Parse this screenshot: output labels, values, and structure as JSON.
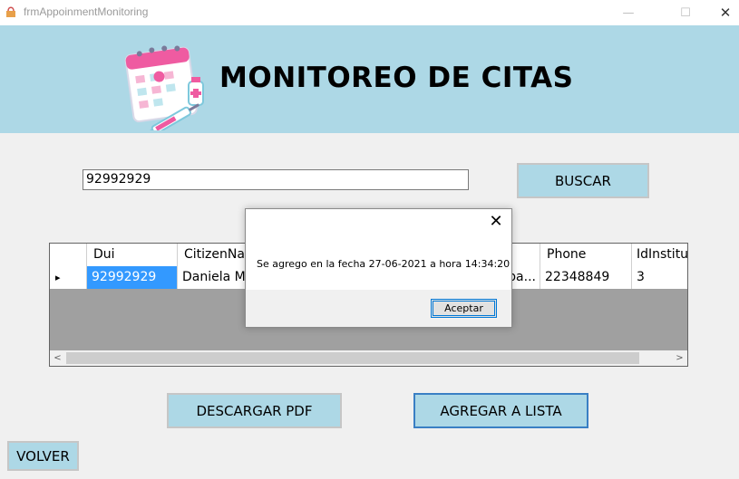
{
  "window": {
    "title": "frmAppoinmentMonitoring",
    "minimize_glyph": "—",
    "maximize_glyph": "☐",
    "close_glyph": "✕"
  },
  "header": {
    "title": "MONITOREO DE CITAS",
    "background": "#add8e6"
  },
  "search": {
    "value": "92992929",
    "button_label": "BUSCAR"
  },
  "grid": {
    "columns": [
      "Dui",
      "CitizenNa",
      "",
      "Phone",
      "IdInstitu"
    ],
    "rows": [
      {
        "selected_indicator": "▸",
        "cells": [
          "92992929",
          "Daniela M",
          "pa...",
          "22348849",
          "3"
        ]
      }
    ],
    "scroll_left": "<",
    "scroll_right": ">"
  },
  "dialog": {
    "message": "Se agrego en la fecha 27-06-2021 a hora 14:34:20",
    "ok_label": "Aceptar",
    "close_glyph": "✕"
  },
  "actions": {
    "pdf_label": "DESCARGAR PDF",
    "add_label": "AGREGAR A LISTA",
    "back_label": "VOLVER"
  },
  "colors": {
    "accent": "#add8e6",
    "selection": "#3399ff",
    "grid_empty": "#a0a0a0"
  },
  "icons": {
    "app": "app-icon",
    "logo": "calendar-medical-icon"
  }
}
